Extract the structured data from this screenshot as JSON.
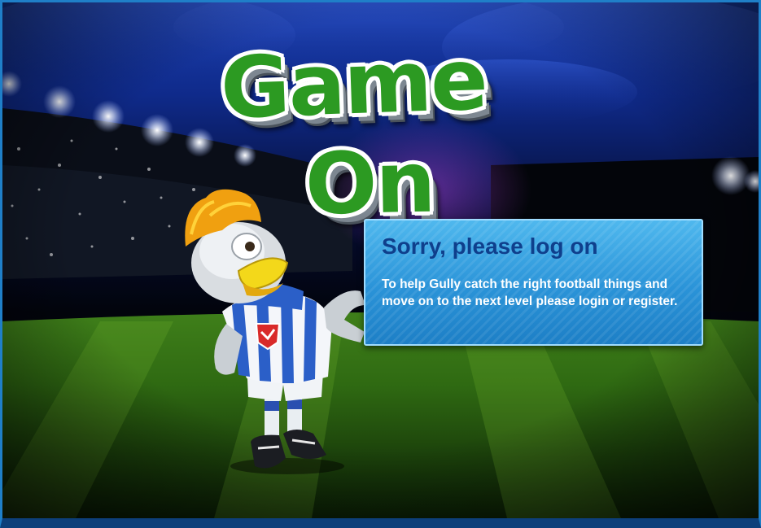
{
  "title": {
    "line1": "Game",
    "line2": "On"
  },
  "message": {
    "heading": "Sorry, please log on",
    "body": "To help Gully catch the right football things and move on to the next level please login or register."
  },
  "colors": {
    "frame": "#1f7fc8",
    "title_green": "#2c9a22",
    "panel_blue": "#2a93d8",
    "heading_blue": "#0f3f8c",
    "body_text": "#ffffff"
  },
  "mascot": {
    "shirt_badge_icon": "checkmark-shield-icon"
  }
}
